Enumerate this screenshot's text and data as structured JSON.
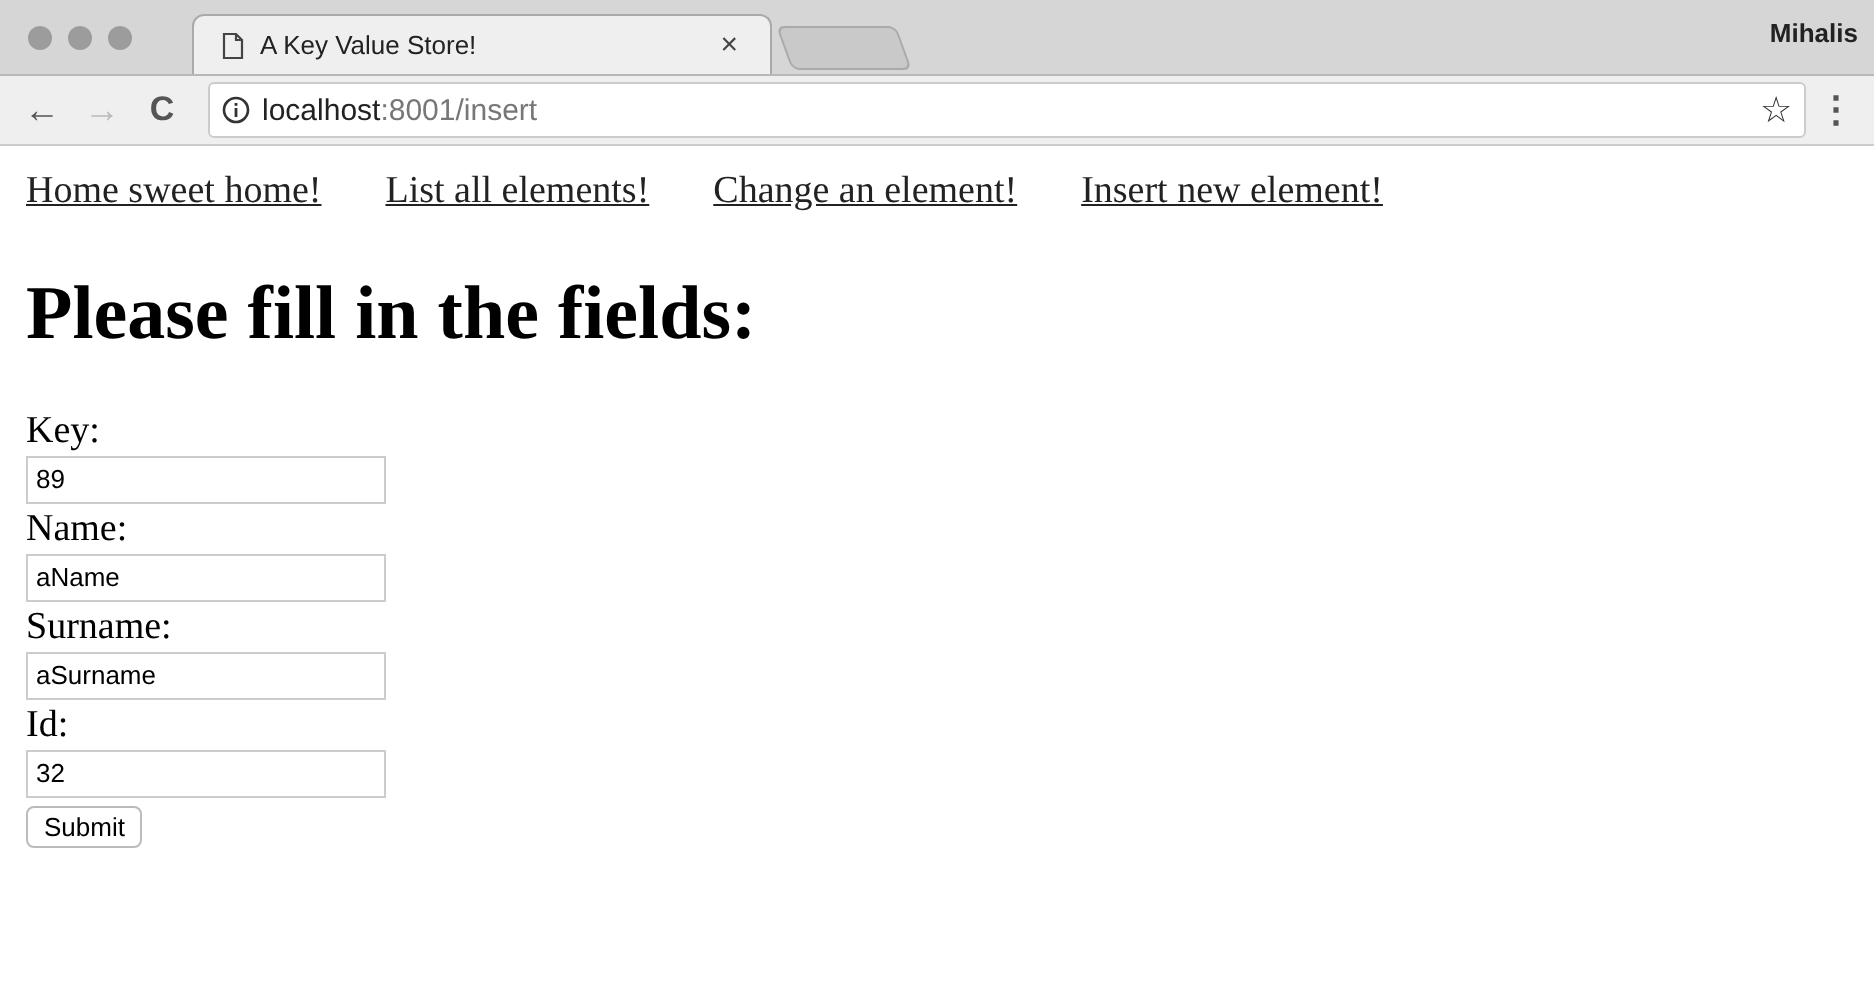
{
  "window": {
    "user": "Mihalis"
  },
  "tabs": [
    {
      "title": "A Key Value Store!",
      "close": "×",
      "selected": true
    }
  ],
  "toolbar": {
    "back": "←",
    "forward": "→",
    "reload": "C",
    "url_host": "localhost",
    "url_path": ":8001/insert",
    "star": "☆",
    "menu": "⋮"
  },
  "nav_links": [
    "Home sweet home!",
    "List all elements!",
    "Change an element!",
    "Insert new element!"
  ],
  "heading": "Please fill in the fields:",
  "fields": [
    {
      "label": "Key:",
      "value": "89"
    },
    {
      "label": "Name:",
      "value": "aName"
    },
    {
      "label": "Surname:",
      "value": "aSurname"
    },
    {
      "label": "Id:",
      "value": "32"
    }
  ],
  "submit": "Submit"
}
